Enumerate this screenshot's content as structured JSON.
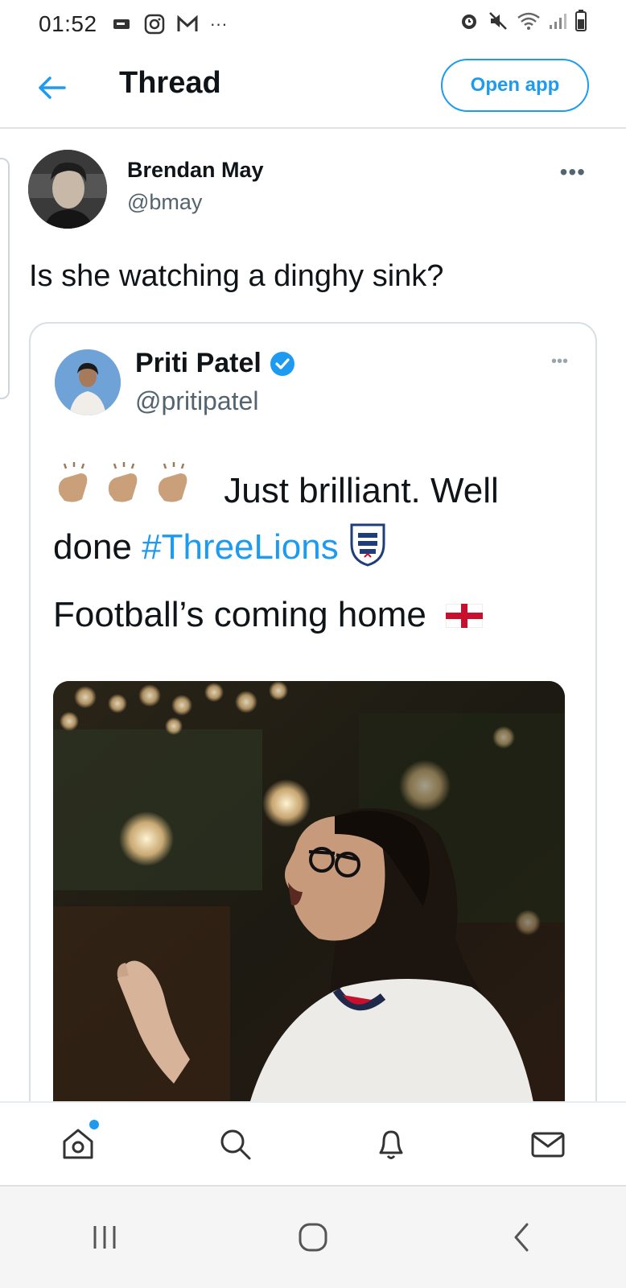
{
  "status_bar": {
    "time": "01:52",
    "left_icons": [
      "notification-icon",
      "instagram-icon",
      "gmail-icon",
      "more-dots-icon"
    ],
    "right_icons": [
      "alarm-icon",
      "mute-icon",
      "wifi-icon",
      "signal-icon",
      "battery-icon"
    ]
  },
  "header": {
    "title": "Thread",
    "open_app_label": "Open app"
  },
  "tweet": {
    "author_name": "Brendan May",
    "author_handle": "@bmay",
    "text": "Is she watching a dinghy sink?"
  },
  "quoted_tweet": {
    "author_name": "Priti Patel",
    "author_handle": "@pritipatel",
    "line1_text": "Just brilliant. Well",
    "line2_prefix": "done ",
    "hashtag": "#ThreeLions",
    "line3_text": "Football’s coming home"
  },
  "bottom_nav": {
    "items": [
      "home-icon",
      "search-icon",
      "notifications-icon",
      "messages-icon"
    ]
  },
  "android_nav": {
    "items": [
      "recent-apps-icon",
      "home-circle-icon",
      "back-chevron-icon"
    ]
  },
  "colors": {
    "accent": "#1d9bf0",
    "text": "#0f1419",
    "secondary_text": "#536471"
  }
}
